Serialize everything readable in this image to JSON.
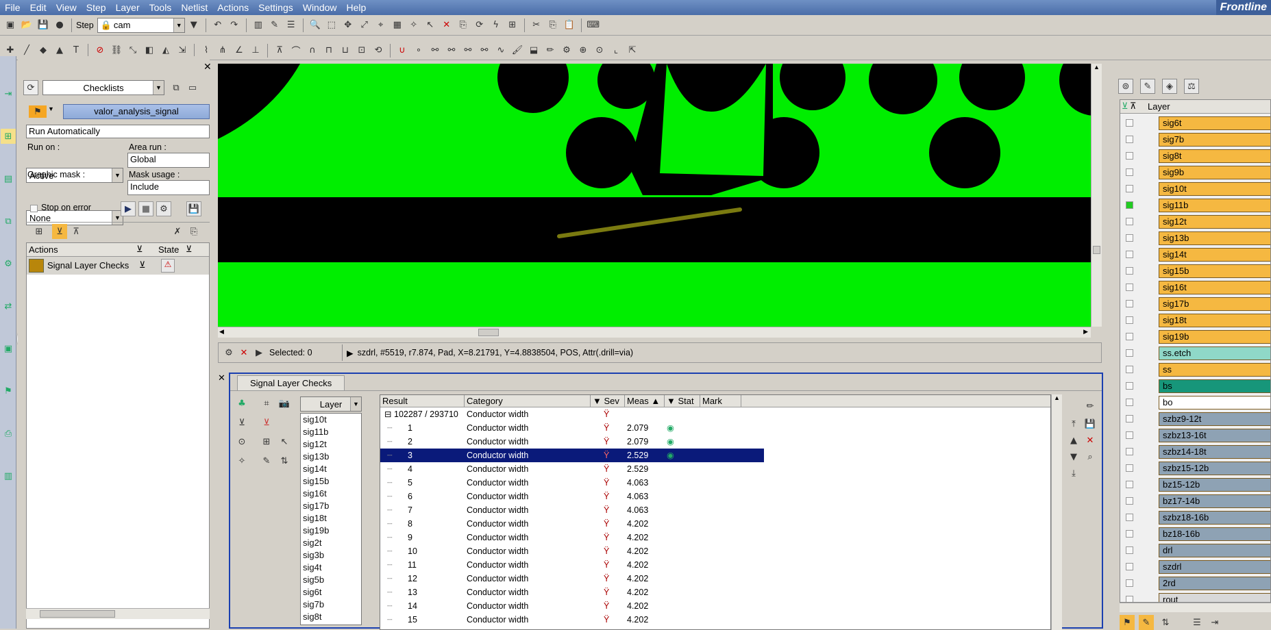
{
  "menu": [
    "File",
    "Edit",
    "View",
    "Step",
    "Layer",
    "Tools",
    "Netlist",
    "Actions",
    "Settings",
    "Window",
    "Help"
  ],
  "brand": "Frontline",
  "toolbar": {
    "step_label": "Step",
    "step_value": "cam"
  },
  "checklist": {
    "combo": "Checklists",
    "name": "valor_analysis_signal",
    "run_mode": "Run Automatically",
    "run_on_label": "Run on :",
    "run_on": "Active",
    "area_run_label": "Area run :",
    "area_run": "Global",
    "graphic_mask_label": "Graphic mask :",
    "graphic_mask": "None",
    "mask_usage_label": "Mask usage :",
    "mask_usage": "Include",
    "stop_on_error": "Stop on error",
    "actions_header": "Actions",
    "state_header": "State",
    "action_item": "Signal Layer Checks"
  },
  "status": {
    "selected": "Selected: 0",
    "info": "szdrl, #5519, r7.874, Pad, X=8.21791, Y=4.8838504, POS, Attr(.drill=via)"
  },
  "checks": {
    "tab": "Signal Layer Checks",
    "layer_header": "Layer",
    "layers": [
      "sig10t",
      "sig11b",
      "sig12t",
      "sig13b",
      "sig14t",
      "sig15b",
      "sig16t",
      "sig17b",
      "sig18t",
      "sig19b",
      "sig2t",
      "sig3b",
      "sig4t",
      "sig5b",
      "sig6t",
      "sig7b",
      "sig8t"
    ],
    "columns": {
      "result": "Result",
      "category": "Category",
      "sev": "Sev",
      "meas": "Meas",
      "stat": "Stat",
      "mark": "Mark"
    },
    "root": "102287 / 293710",
    "root_category": "Conductor width",
    "rows": [
      {
        "id": "1",
        "category": "Conductor width",
        "meas": "2.079"
      },
      {
        "id": "2",
        "category": "Conductor width",
        "meas": "2.079"
      },
      {
        "id": "3",
        "category": "Conductor width",
        "meas": "2.529"
      },
      {
        "id": "4",
        "category": "Conductor width",
        "meas": "2.529"
      },
      {
        "id": "5",
        "category": "Conductor width",
        "meas": "4.063"
      },
      {
        "id": "6",
        "category": "Conductor width",
        "meas": "4.063"
      },
      {
        "id": "7",
        "category": "Conductor width",
        "meas": "4.063"
      },
      {
        "id": "8",
        "category": "Conductor width",
        "meas": "4.202"
      },
      {
        "id": "9",
        "category": "Conductor width",
        "meas": "4.202"
      },
      {
        "id": "10",
        "category": "Conductor width",
        "meas": "4.202"
      },
      {
        "id": "11",
        "category": "Conductor width",
        "meas": "4.202"
      },
      {
        "id": "12",
        "category": "Conductor width",
        "meas": "4.202"
      },
      {
        "id": "13",
        "category": "Conductor width",
        "meas": "4.202"
      },
      {
        "id": "14",
        "category": "Conductor width",
        "meas": "4.202"
      },
      {
        "id": "15",
        "category": "Conductor width",
        "meas": "4.202"
      }
    ],
    "selected_row": "3"
  },
  "layers_panel": {
    "header": "Layer",
    "items": [
      {
        "name": "sig6t",
        "color": "#f5b841"
      },
      {
        "name": "sig7b",
        "color": "#f5b841"
      },
      {
        "name": "sig8t",
        "color": "#f5b841"
      },
      {
        "name": "sig9b",
        "color": "#f5b841"
      },
      {
        "name": "sig10t",
        "color": "#f5b841"
      },
      {
        "name": "sig11b",
        "color": "#f5b841"
      },
      {
        "name": "sig12t",
        "color": "#f5b841"
      },
      {
        "name": "sig13b",
        "color": "#f5b841"
      },
      {
        "name": "sig14t",
        "color": "#f5b841"
      },
      {
        "name": "sig15b",
        "color": "#f5b841"
      },
      {
        "name": "sig16t",
        "color": "#f5b841"
      },
      {
        "name": "sig17b",
        "color": "#f5b841"
      },
      {
        "name": "sig18t",
        "color": "#f5b841"
      },
      {
        "name": "sig19b",
        "color": "#f5b841"
      },
      {
        "name": "ss.etch",
        "color": "#8fd8c8"
      },
      {
        "name": "ss",
        "color": "#f5b841"
      },
      {
        "name": "bs",
        "color": "#17967a"
      },
      {
        "name": "bo",
        "color": "#ffffff"
      },
      {
        "name": "szbz9-12t",
        "color": "#8ea2b4"
      },
      {
        "name": "szbz13-16t",
        "color": "#8ea2b4"
      },
      {
        "name": "szbz14-18t",
        "color": "#8ea2b4"
      },
      {
        "name": "szbz15-12b",
        "color": "#8ea2b4"
      },
      {
        "name": "bz15-12b",
        "color": "#8ea2b4"
      },
      {
        "name": "bz17-14b",
        "color": "#8ea2b4"
      },
      {
        "name": "szbz18-16b",
        "color": "#8ea2b4"
      },
      {
        "name": "bz18-16b",
        "color": "#8ea2b4"
      },
      {
        "name": "drl",
        "color": "#8ea2b4"
      },
      {
        "name": "szdrl",
        "color": "#8ea2b4"
      },
      {
        "name": "2rd",
        "color": "#8ea2b4"
      },
      {
        "name": "rout",
        "color": "#d8d8d8"
      }
    ]
  },
  "colors": {
    "copper": "#00ee00",
    "background": "#000000",
    "selection": "#0a1a7a",
    "trace": "#7a7a10"
  }
}
